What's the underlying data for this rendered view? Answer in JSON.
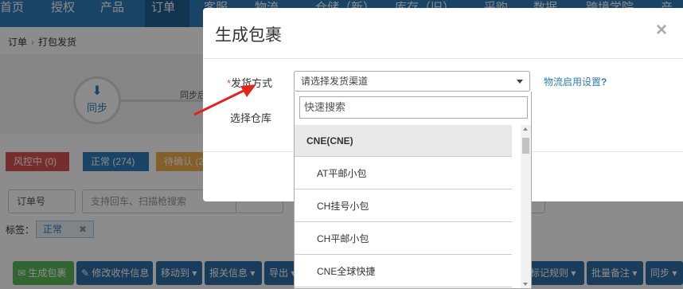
{
  "topnav": {
    "items": [
      "首页",
      "授权",
      "产品",
      "订单",
      "客服",
      "物流",
      "仓储（新）",
      "库存（旧）",
      "采购",
      "数据",
      "跨境学院",
      "产品"
    ]
  },
  "breadcrumb": {
    "root": "订单",
    "current": "打包发货"
  },
  "steps": {
    "current_label": "同步",
    "next_label": "同步后"
  },
  "status_tabs": {
    "risk": "风控中 (0)",
    "normal": "正常 (274)",
    "confirm": "待确认 (2"
  },
  "filter": {
    "order_select": "订单号",
    "search_placeholder": "支持回车、扫描枪搜索"
  },
  "tags": {
    "label": "标签：",
    "chip": "正常"
  },
  "actions": {
    "generate": "生成包裹",
    "edit_address": "修改收件信息",
    "move_to": "移动到",
    "customs": "报关信息",
    "export": "导出",
    "mark_rules": "标记规则",
    "batch_note": "批量备注",
    "sync": "同步"
  },
  "modal": {
    "title": "生成包裹",
    "close": "×",
    "shipping_method_label": "发货方式",
    "required_mark": "*",
    "warehouse_label": "选择仓库",
    "select_placeholder": "请选择发货渠道",
    "help_link": "物流启用设置",
    "help_mark": "?"
  },
  "dropdown": {
    "search_placeholder": "快速搜索",
    "group": "CNE(CNE)",
    "options": [
      "AT平邮小包",
      "CH挂号小包",
      "CH平邮小包",
      "CNE全球快捷"
    ]
  },
  "colors": {
    "nav_bg": "#2e7cb8",
    "risk": "#d9534f",
    "normal": "#2e7cb8",
    "confirm": "#f0ad4e",
    "green_button": "#5cb85c",
    "arrow": "#e0261b"
  }
}
